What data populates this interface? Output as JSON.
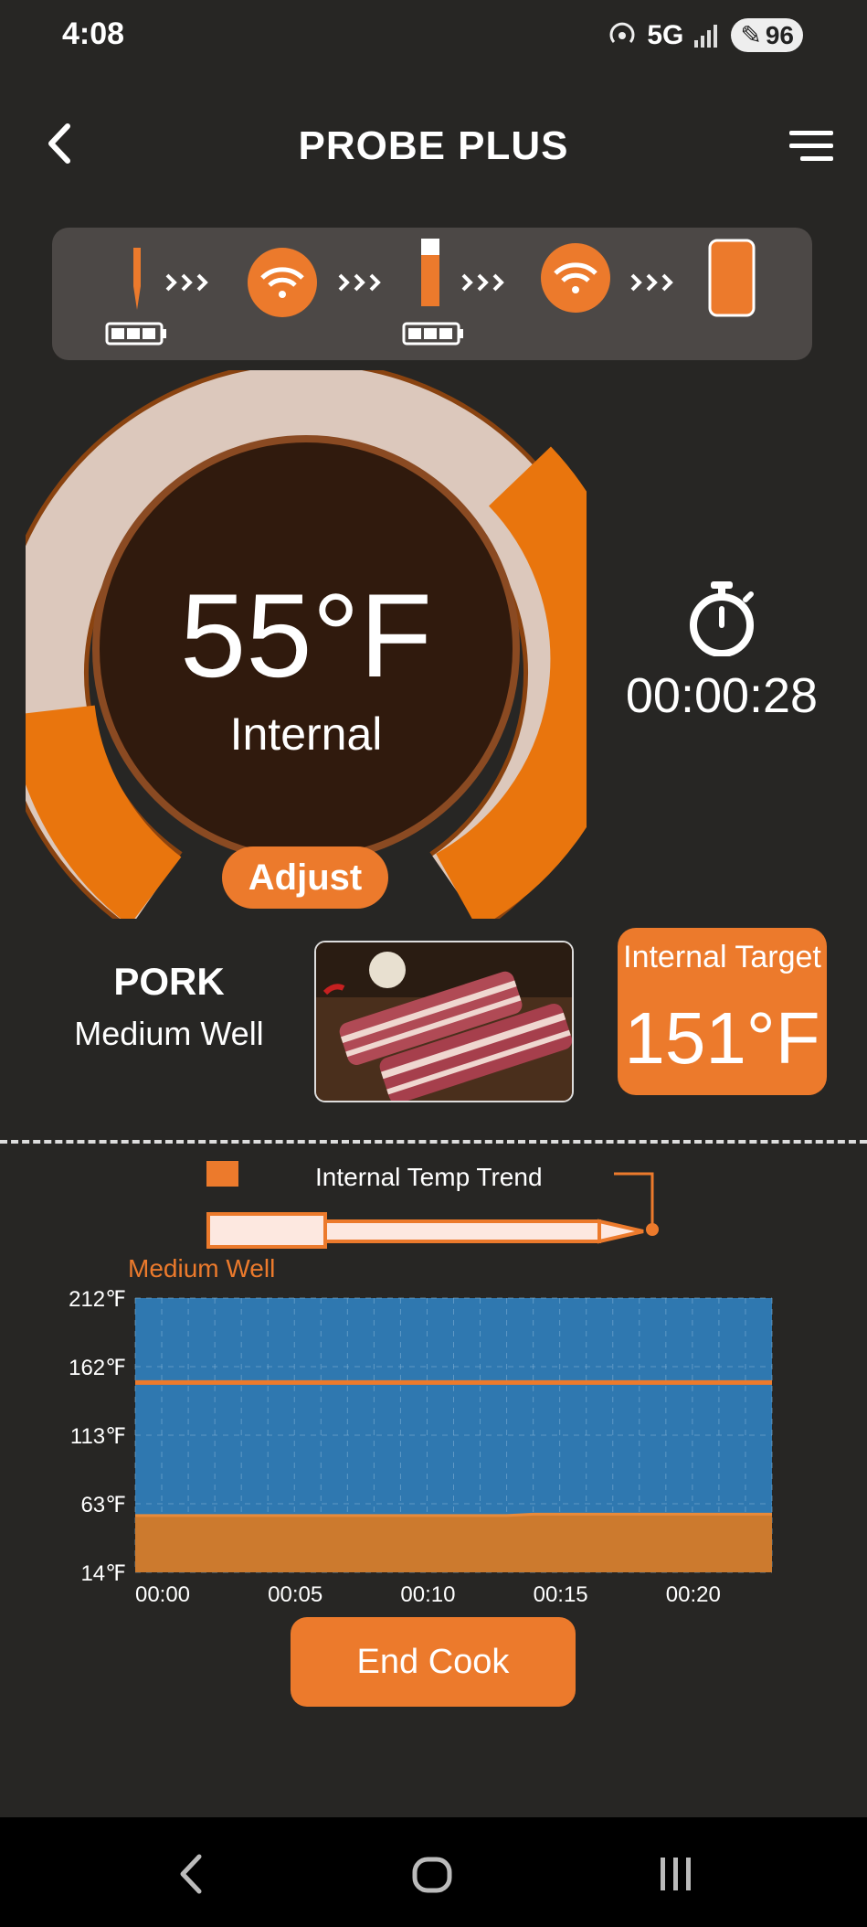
{
  "status_bar": {
    "time": "4:08",
    "network": "5G",
    "battery": "96"
  },
  "header": {
    "title": "PROBE PLUS"
  },
  "gauge": {
    "temperature": "55°F",
    "label": "Internal",
    "adjust_label": "Adjust",
    "level_fraction": 0.55
  },
  "timer": {
    "elapsed": "00:00:28"
  },
  "cook": {
    "meat": "PORK",
    "doneness": "Medium Well"
  },
  "target": {
    "label": "Internal Target",
    "value": "151°F"
  },
  "chart": {
    "title": "Internal Temp Trend",
    "band_label": "Medium Well"
  },
  "chart_data": {
    "type": "area",
    "title": "Internal Temp Trend",
    "x_ticks": [
      "00:00",
      "00:05",
      "00:10",
      "00:15",
      "00:20"
    ],
    "y_ticks": [
      "14℉",
      "63℉",
      "113℉",
      "162℉",
      "212℉"
    ],
    "ylim": [
      14,
      212
    ],
    "target_line": 151,
    "series": [
      {
        "x": [
          0,
          5,
          10,
          14,
          15,
          20,
          24
        ],
        "values": [
          55,
          55,
          55,
          55,
          56,
          56,
          56
        ]
      }
    ],
    "grid": true
  },
  "footer": {
    "end_cook_label": "End Cook"
  },
  "colors": {
    "accent": "#ec7a2c",
    "background": "#272624",
    "chart_bg": "#2f78b0",
    "gauge_track": "#dcc8bc",
    "gauge_center": "#301a0d"
  },
  "icons": {
    "probe": "probe-icon",
    "wifi": "wifi-icon",
    "booster": "booster-icon",
    "phone": "phone-icon",
    "timer": "stopwatch-icon"
  }
}
